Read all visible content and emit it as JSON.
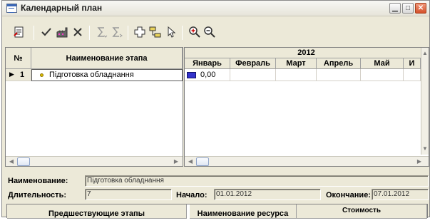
{
  "window": {
    "title": "Календарный план"
  },
  "stages": {
    "header_no": "№",
    "header_name": "Наименование этапа",
    "rows": [
      {
        "no": "1",
        "name": "Підготовка обладнання"
      }
    ]
  },
  "gantt": {
    "year": "2012",
    "months": [
      "Январь",
      "Февраль",
      "Март",
      "Апрель",
      "Май",
      "И"
    ],
    "row_value": "0,00"
  },
  "details": {
    "name_label": "Наименование:",
    "name_value": "Підготовка обладнання",
    "duration_label": "Длительность:",
    "duration_value": "7",
    "start_label": "Начало:",
    "start_value": "01.01.2012",
    "end_label": "Окончание:",
    "end_value": "07.01.2012"
  },
  "bottom_headers": {
    "prev_stages": "Предшествующие этапы",
    "resource_name": "Наименование ресурса",
    "cost": "Стоимость"
  },
  "colors": {
    "bar": "#3333cc",
    "marker": "#e0c000"
  }
}
